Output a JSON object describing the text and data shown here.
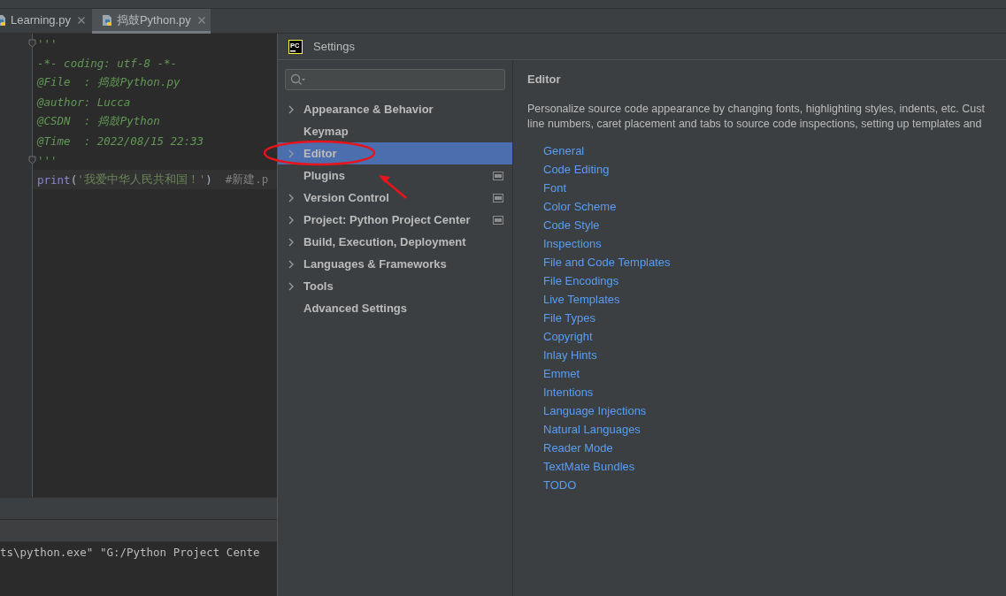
{
  "editor_tabs": [
    {
      "label": "Learning.py",
      "selected": false
    },
    {
      "label": "捣鼓Python.py",
      "selected": true
    }
  ],
  "code_lines": [
    {
      "fold": true,
      "current": false,
      "segments": [
        {
          "kind": "doc",
          "text": "'''"
        }
      ]
    },
    {
      "fold": false,
      "current": false,
      "segments": [
        {
          "kind": "doc",
          "text": "-*- coding: utf-8 -*-"
        }
      ]
    },
    {
      "fold": false,
      "current": false,
      "segments": [
        {
          "kind": "doc",
          "text": "@File  : 捣鼓Python.py"
        }
      ]
    },
    {
      "fold": false,
      "current": false,
      "segments": [
        {
          "kind": "doc",
          "text": "@author: Lucca"
        }
      ]
    },
    {
      "fold": false,
      "current": false,
      "segments": [
        {
          "kind": "doc",
          "text": "@CSDN  : 捣鼓Python"
        }
      ]
    },
    {
      "fold": false,
      "current": false,
      "segments": [
        {
          "kind": "doc",
          "text": "@Time  : 2022/08/15 22:33"
        }
      ]
    },
    {
      "fold": true,
      "current": false,
      "segments": [
        {
          "kind": "doc",
          "text": "'''"
        }
      ]
    },
    {
      "fold": false,
      "current": true,
      "segments": [
        {
          "kind": "builtin",
          "text": "print"
        },
        {
          "kind": "plain",
          "text": "("
        },
        {
          "kind": "string",
          "text": "'我爱中华人民共和国！'"
        },
        {
          "kind": "plain",
          "text": ")  "
        },
        {
          "kind": "comment",
          "text": "#新建.p"
        }
      ]
    }
  ],
  "console": {
    "line": "ts\\python.exe\" \"G:/Python Project Cente"
  },
  "dialog": {
    "title": "Settings",
    "logo": "PC",
    "tree": [
      {
        "label": "Appearance & Behavior",
        "expandable": true,
        "selected": false,
        "project_icon": false
      },
      {
        "label": "Keymap",
        "expandable": false,
        "selected": false,
        "project_icon": false
      },
      {
        "label": "Editor",
        "expandable": true,
        "selected": true,
        "project_icon": false
      },
      {
        "label": "Plugins",
        "expandable": false,
        "selected": false,
        "project_icon": true
      },
      {
        "label": "Version Control",
        "expandable": true,
        "selected": false,
        "project_icon": true
      },
      {
        "label": "Project: Python Project Center",
        "expandable": true,
        "selected": false,
        "project_icon": true
      },
      {
        "label": "Build, Execution, Deployment",
        "expandable": true,
        "selected": false,
        "project_icon": false
      },
      {
        "label": "Languages & Frameworks",
        "expandable": true,
        "selected": false,
        "project_icon": false
      },
      {
        "label": "Tools",
        "expandable": true,
        "selected": false,
        "project_icon": false
      },
      {
        "label": "Advanced Settings",
        "expandable": false,
        "selected": false,
        "project_icon": false
      }
    ],
    "heading": "Editor",
    "description": [
      "Personalize source code appearance by changing fonts, highlighting styles, indents, etc. Cust",
      "line numbers, caret placement and tabs to source code inspections, setting up templates and"
    ],
    "links": [
      "General",
      "Code Editing",
      "Font",
      "Color Scheme",
      "Code Style",
      "Inspections",
      "File and Code Templates",
      "File Encodings",
      "Live Templates",
      "File Types",
      "Copyright",
      "Inlay Hints",
      "Emmet",
      "Intentions",
      "Language Injections",
      "Natural Languages",
      "Reader Mode",
      "TextMate Bundles",
      "TODO"
    ]
  }
}
